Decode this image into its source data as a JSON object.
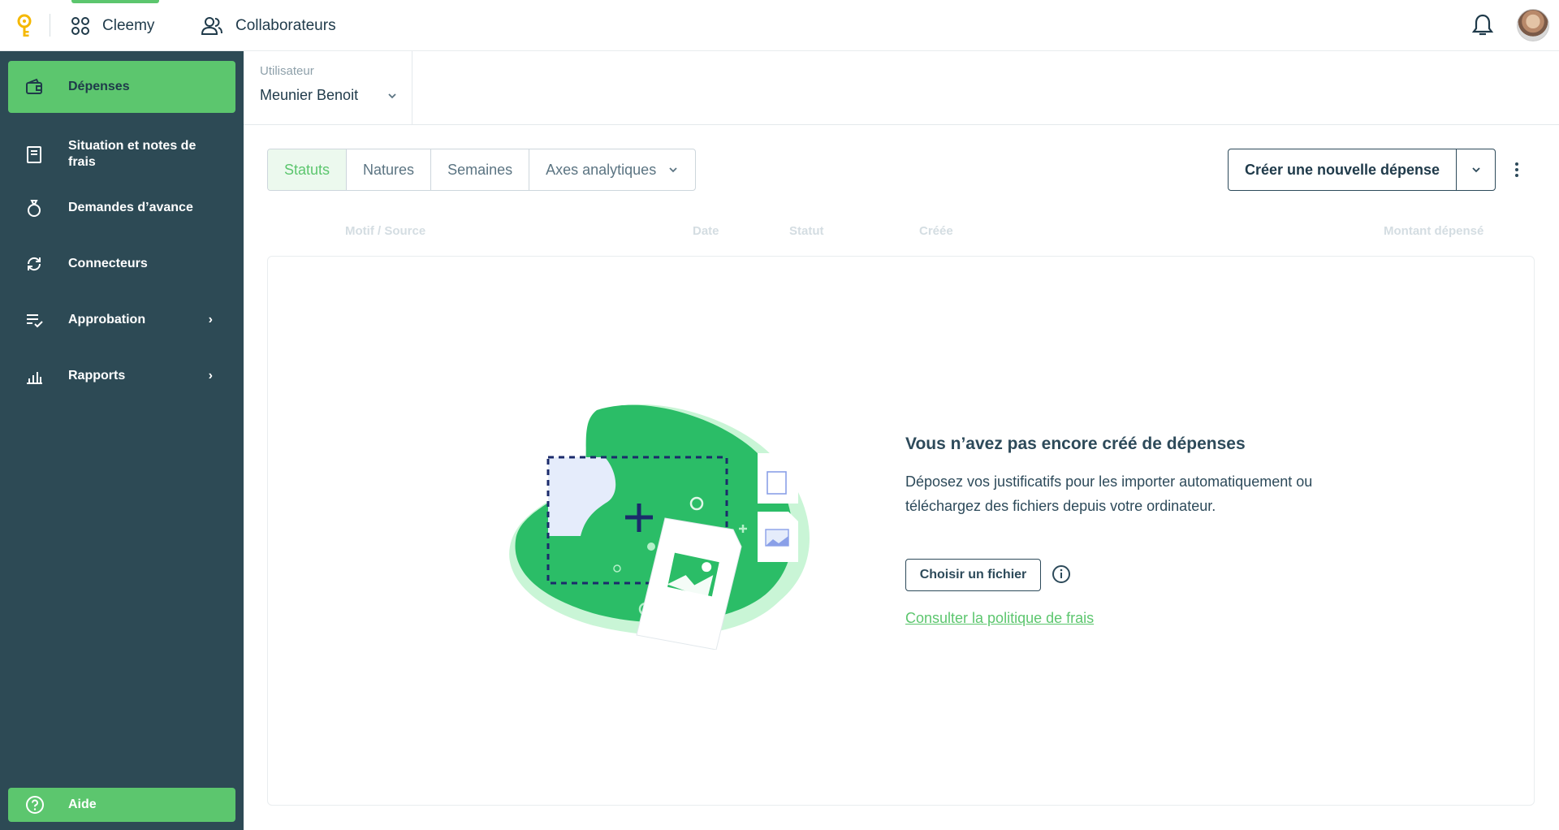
{
  "topbar": {
    "app_label": "Cleemy",
    "collab_label": "Collaborateurs"
  },
  "sidebar": {
    "items": [
      {
        "label": "Dépenses",
        "icon": "wallet-icon",
        "active": true
      },
      {
        "label": "Situation et notes de frais",
        "icon": "receipt-icon"
      },
      {
        "label": "Demandes d’avance",
        "icon": "money-bag-icon"
      },
      {
        "label": "Connecteurs",
        "icon": "sync-icon"
      },
      {
        "label": "Approbation",
        "icon": "list-check-icon",
        "chevron": "›"
      },
      {
        "label": "Rapports",
        "icon": "bar-chart-icon",
        "chevron": "›"
      }
    ],
    "help_label": "Aide"
  },
  "filter": {
    "user_label": "Utilisateur",
    "user_value": "Meunier Benoit"
  },
  "tabs": [
    "Statuts",
    "Natures",
    "Semaines",
    "Axes analytiques"
  ],
  "actions": {
    "create_label": "Créer une nouvelle dépense"
  },
  "table": {
    "columns": [
      "Motif / Source",
      "Date",
      "Statut",
      "Créée",
      "Montant dépensé"
    ]
  },
  "empty": {
    "title": "Vous n’avez pas encore créé de dépenses",
    "description": "Déposez vos justificatifs pour les importer automatiquement ou téléchargez des fichiers depuis votre ordinateur.",
    "choose_label": "Choisir un fichier",
    "policy_link": "Consulter la politique de frais"
  },
  "colors": {
    "accent": "#5cc66e",
    "sidebar_bg": "#2d4a55",
    "text": "#2d4a5a"
  }
}
